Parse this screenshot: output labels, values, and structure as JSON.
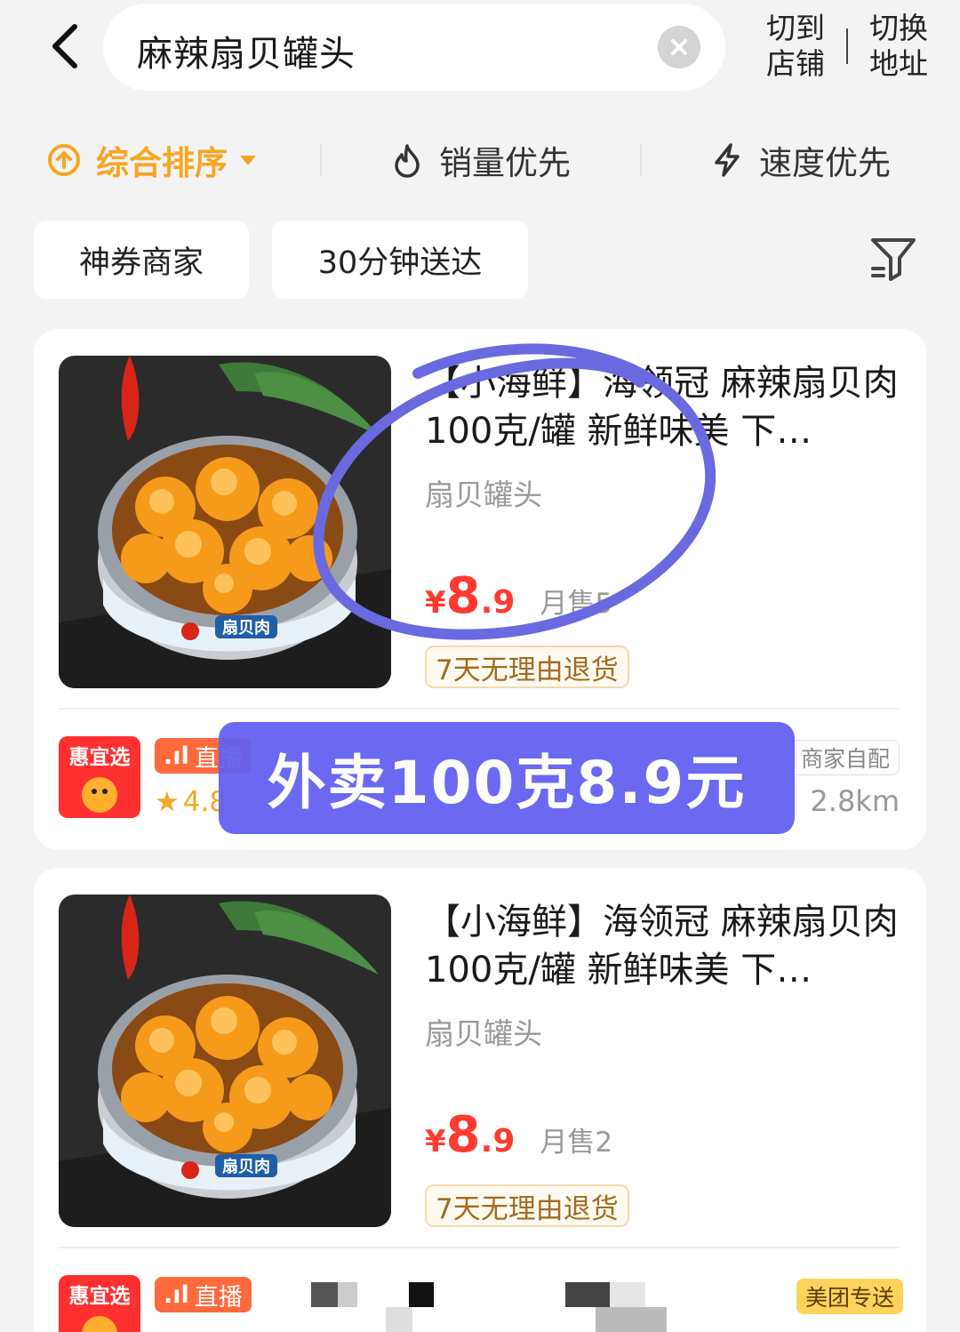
{
  "header": {
    "search_value": "麻辣扇贝罐头",
    "shop_link": [
      "切到",
      "店铺"
    ],
    "address_link": [
      "切换",
      "地址"
    ]
  },
  "sort": {
    "items": [
      {
        "label": "综合排序",
        "icon": "arrow-up-circle-icon"
      },
      {
        "label": "销量优先",
        "icon": "flame-icon"
      },
      {
        "label": "速度优先",
        "icon": "lightning-icon"
      }
    ]
  },
  "filters": {
    "chips": [
      "神券商家",
      "30分钟送达"
    ]
  },
  "products": [
    {
      "title": "【小海鲜】海领冠 麻辣扇贝肉100克/罐 新鲜味美 下…",
      "subtitle": "扇贝罐头",
      "price_yen": "¥",
      "price_int": "8",
      "price_dec": ".9",
      "sold": "月售5",
      "return_tag": "7天无理由退货",
      "shop_logo": "惠宜选",
      "live_badge": "直播",
      "rating": "4.8",
      "delivery_tag": "商家自配",
      "distance": "2.8km"
    },
    {
      "title": "【小海鲜】海领冠 麻辣扇贝肉100克/罐 新鲜味美 下…",
      "subtitle": "扇贝罐头",
      "price_yen": "¥",
      "price_int": "8",
      "price_dec": ".9",
      "sold": "月售2",
      "return_tag": "7天无理由退货",
      "shop_logo": "惠宜选",
      "live_badge": "直播",
      "delivery_tag": "美团专送"
    }
  ],
  "can_label": "扇贝肉",
  "overlay_caption": "外卖100克8.9元",
  "colors": {
    "accent": "#f5a623",
    "price": "#ff3b30",
    "overlay": "#6260f0"
  }
}
